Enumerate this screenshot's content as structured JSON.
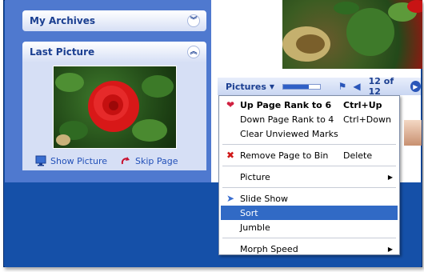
{
  "sidebar": {
    "archives": {
      "title": "My Archives",
      "toggle_icon": "chevron-double-down-icon"
    },
    "last_picture": {
      "title": "Last Picture",
      "toggle_icon": "chevron-double-up-icon",
      "tasks": [
        {
          "label": "Show Picture",
          "icon": "monitor-icon"
        },
        {
          "label": "Skip Page",
          "icon": "redo-arrow-icon"
        }
      ]
    }
  },
  "toolbar": {
    "label": "Pictures",
    "progress": 0.7,
    "counter": "12 of 12"
  },
  "menu": {
    "items": [
      {
        "label": "Up Page Rank to 6",
        "shortcut": "Ctrl+Up",
        "icon": "heart-icon",
        "bold": true
      },
      {
        "label": "Down Page Rank to 4",
        "shortcut": "Ctrl+Down"
      },
      {
        "label": "Clear Unviewed Marks",
        "shortcut": ""
      },
      {
        "label": "Remove Page to Bin",
        "shortcut": "Delete",
        "icon": "red-x-icon"
      },
      {
        "label": "Picture",
        "submenu": true
      },
      {
        "label": "Slide Show",
        "icon": "slideshow-arrow-icon"
      },
      {
        "label": "Sort",
        "highlighted": true
      },
      {
        "label": "Jumble"
      },
      {
        "label": "Morph Speed",
        "submenu": true
      }
    ]
  },
  "colors": {
    "window_blue": "#1550a8",
    "panel_blue": "#4f79cf",
    "menu_highlight": "#316ac5"
  }
}
